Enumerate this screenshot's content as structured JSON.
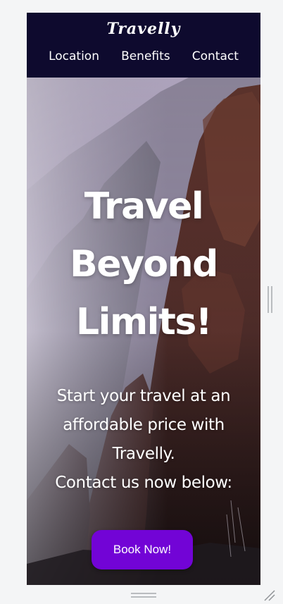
{
  "navbar": {
    "brand": "Travelly",
    "links": [
      {
        "label": "Location"
      },
      {
        "label": "Benefits"
      },
      {
        "label": "Contact"
      }
    ],
    "background_color": "#0e0a2e"
  },
  "hero": {
    "title_lines": [
      "Travel",
      "Beyond",
      "Limits!"
    ],
    "subtitle_lines": [
      "Start your travel at an",
      "affordable price with",
      "Travelly.",
      "Contact us now below:"
    ],
    "button_label": "Book Now!",
    "button_color": "#7204d6",
    "background_image": "misty-mountain-cliff-photo"
  },
  "device_chrome": {
    "vertical_resize_handle": "vertical-drag-handle-icon",
    "horizontal_resize_handle": "horizontal-drag-handle-icon",
    "corner_grip": "resize-grip-icon"
  }
}
